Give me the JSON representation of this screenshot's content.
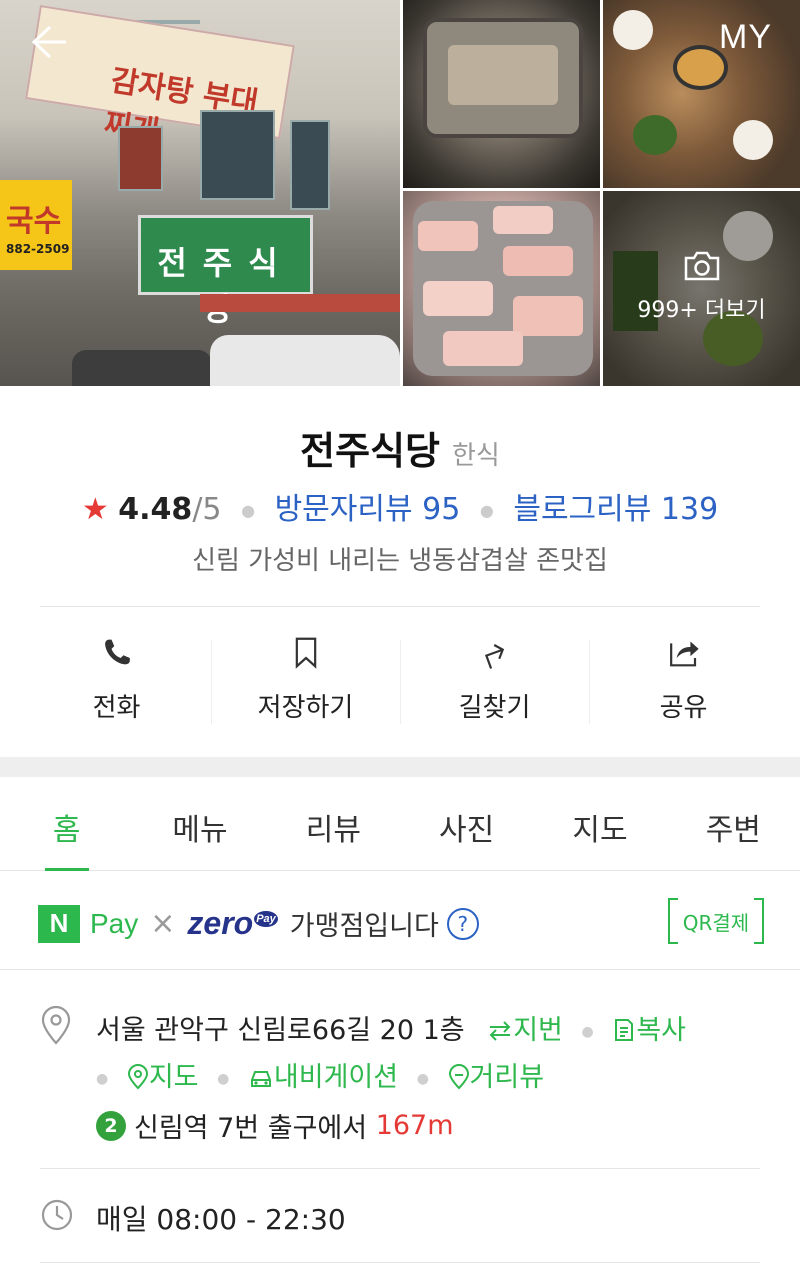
{
  "header": {
    "back_icon": "arrow-left-icon",
    "my_label": "MY",
    "more_photos_label": "999+ 더보기",
    "storefront_signs": {
      "main_sign": "감자탕 부대찌개",
      "yellow_sign": "국수",
      "yellow_phone": "882-2509",
      "green_sign": "전주식당"
    }
  },
  "place": {
    "name": "전주식당",
    "category": "한식",
    "rating": "4.48",
    "rating_max": "/5",
    "visitor_reviews": "방문자리뷰 95",
    "blog_reviews": "블로그리뷰 139",
    "description": "신림 가성비 내리는 냉동삼겹살 존맛집"
  },
  "actions": [
    {
      "label": "전화",
      "icon": "phone-icon"
    },
    {
      "label": "저장하기",
      "icon": "bookmark-icon"
    },
    {
      "label": "길찾기",
      "icon": "directions-icon"
    },
    {
      "label": "공유",
      "icon": "share-icon"
    }
  ],
  "tabs": [
    {
      "label": "홈",
      "active": true
    },
    {
      "label": "메뉴",
      "active": false
    },
    {
      "label": "리뷰",
      "active": false
    },
    {
      "label": "사진",
      "active": false
    },
    {
      "label": "지도",
      "active": false
    },
    {
      "label": "주변",
      "active": false
    }
  ],
  "payment": {
    "npay_n": "N",
    "npay_label": "Pay",
    "times": "×",
    "zero_label": "zero",
    "zero_sub": "Pay",
    "message": "가맹점입니다",
    "help": "?",
    "qr_label": "QR결제"
  },
  "info": {
    "address": "서울 관악구 신림로66길 20 1층",
    "jibun_label": "지번",
    "copy_label": "복사",
    "map_label": "지도",
    "navigation_label": "내비게이션",
    "street_view_label": "거리뷰",
    "subway_line": "2",
    "station": "신림역",
    "exit_text": "7번 출구에서",
    "distance": "167m",
    "hours": "매일 08:00 - 22:30"
  },
  "colors": {
    "accent_green": "#2fb84e",
    "link_blue": "#2b62c4",
    "star_red": "#e53935",
    "subway_line2": "#33a23d"
  }
}
